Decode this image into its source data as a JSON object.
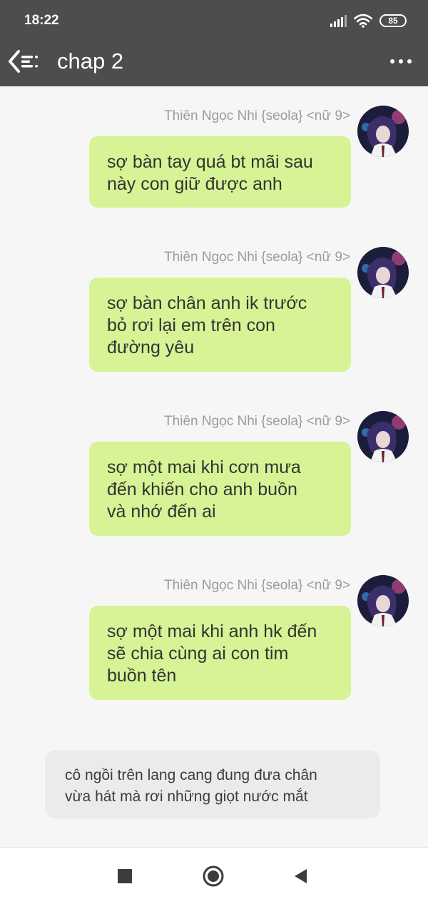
{
  "status_bar": {
    "time": "18:22",
    "battery": "85",
    "signal_icon": "signal-bars-icon",
    "wifi_icon": "wifi-icon"
  },
  "app_bar": {
    "title": "chap 2",
    "back_icon": "back-menu-icon",
    "more_icon": "more-dots-icon"
  },
  "messages": [
    {
      "sender": "Thiên Ngọc Nhi {seola} <nữ 9>",
      "lines": [
        "sợ bàn tay quá bt mãi sau",
        "này con giữ được anh"
      ]
    },
    {
      "sender": "Thiên Ngọc Nhi {seola} <nữ 9>",
      "lines": [
        "sợ bàn chân anh ik trước",
        "bỏ rơi lại em trên con",
        "đường yêu"
      ]
    },
    {
      "sender": "Thiên Ngọc Nhi {seola} <nữ 9>",
      "lines": [
        "sợ một mai khi cơn mưa",
        "đến khiến cho anh buồn",
        "và nhớ đến ai"
      ]
    },
    {
      "sender": "Thiên Ngọc Nhi {seola} <nữ 9>",
      "lines": [
        "sợ một mai khi anh hk đến",
        "sẽ chia cùng ai con tim",
        "buồn tên"
      ]
    }
  ],
  "narration": {
    "lines": [
      "cô ngồi trên lang cang đung đưa chân",
      "vừa hát mà rơi những giọt nước mắt"
    ]
  },
  "nav_bar": {
    "recent_icon": "square-recents-icon",
    "home_icon": "circle-home-icon",
    "back_icon": "triangle-back-icon"
  },
  "colors": {
    "app_bar": "#4d4d4d",
    "bubble": "#d6f495",
    "background": "#f6f6f6",
    "narration_bg": "#ebebeb"
  }
}
